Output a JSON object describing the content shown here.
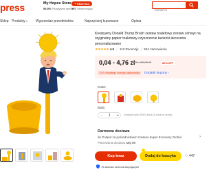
{
  "header": {
    "brand": "press",
    "store_name": "My Hopes Store",
    "store_chevron": "›",
    "store_positive_pct": "94.8%",
    "store_positive_label": "Pozytywne opinie",
    "follow_label": "+ Obserwuj",
    "followers_count": "197",
    "followers_label": "Obserwujący",
    "search_placeholder": "Kurasz ra"
  },
  "nav": {
    "items": [
      {
        "label": "Sklep"
      },
      {
        "label": "Produkty"
      },
      {
        "label": "Wyprzedaż przedmiotów"
      },
      {
        "label": "Najczęściej kupowane"
      },
      {
        "label": "Opinia"
      }
    ],
    "chevron": "▾"
  },
  "product": {
    "title": "Kreatywny Donald Trump Brush zestaw toaletowy zestaw uchwyt na oryginalny papier toaletowy czyszczenie łazienki akcesoria personalizowane",
    "stars": "★★★★★",
    "rating": "4.9",
    "reviews": "113 Recenzje",
    "orders": "551 zamówienia",
    "price": "0,04 - 4,76 zł",
    "old_price": "0,20 - 32,38 zł",
    "discount": "80%OFF",
    "promo_note": "3,52 zł każdego nowego użytkownika",
    "coupon_link": "Dodatki kupony",
    "coupon_chevron": "›",
    "color_label": "Kolor:",
    "size_label": "Ilość:",
    "size_value": "1",
    "size_note": "Dostępne tylko 29523 sztuk (1 sztuk na osobę)",
    "colors": [
      "yellow-brush",
      "red-holder",
      "yellow-base",
      "brush-head"
    ]
  },
  "shipping": {
    "title": "Darmowa dostawa",
    "detail": "do Poland za pośrednictwem Cainiao Super Economy Global",
    "date_prefix": "Planowana dostawa",
    "date_value": "Maj 08",
    "chevron": "›"
  },
  "actions": {
    "buy": "Kup teraz",
    "cart": "Dodaj do koszyka",
    "fav_count": "447",
    "protection": "75-dniowa ochrona kupujących"
  },
  "colors": {
    "accent": "#e62e04",
    "cart": "#ffd500",
    "link": "#1f64ff",
    "price_bg": "#fff1ee"
  }
}
